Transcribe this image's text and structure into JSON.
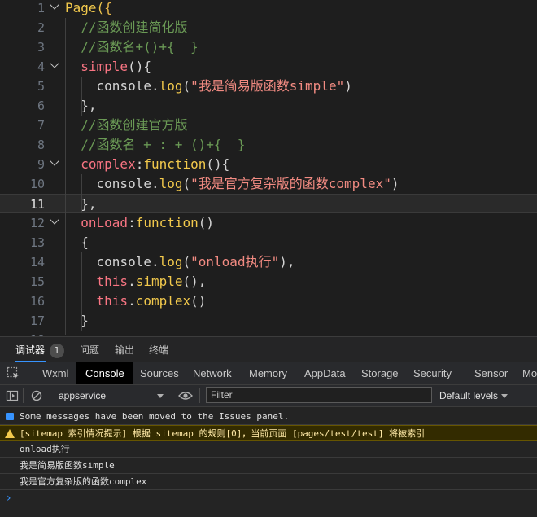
{
  "editor": {
    "lines": [
      {
        "n": "1",
        "segments": [
          {
            "t": "Page(",
            "c": "c-func"
          },
          {
            "t": "{",
            "c": "c-brace"
          }
        ]
      },
      {
        "n": "2",
        "segments": [
          {
            "t": "  //函数创建简化版",
            "c": "c-comment"
          }
        ]
      },
      {
        "n": "3",
        "segments": [
          {
            "t": "  //函数名+()+{  }",
            "c": "c-comment"
          }
        ]
      },
      {
        "n": "4",
        "segments": [
          {
            "t": "  ",
            "c": "c-punc"
          },
          {
            "t": "simple",
            "c": "c-prop"
          },
          {
            "t": "(){",
            "c": "c-punc"
          }
        ]
      },
      {
        "n": "5",
        "segments": [
          {
            "t": "    console.",
            "c": "c-punc"
          },
          {
            "t": "log",
            "c": "c-func"
          },
          {
            "t": "(",
            "c": "c-punc"
          },
          {
            "t": "\"我是简易版函数simple\"",
            "c": "c-str"
          },
          {
            "t": ")",
            "c": "c-punc"
          }
        ]
      },
      {
        "n": "6",
        "segments": [
          {
            "t": "  },",
            "c": "c-punc"
          }
        ]
      },
      {
        "n": "7",
        "segments": [
          {
            "t": "  //函数创建官方版",
            "c": "c-comment"
          }
        ]
      },
      {
        "n": "8",
        "segments": [
          {
            "t": "  //函数名 + : + ()+{  }",
            "c": "c-comment"
          }
        ]
      },
      {
        "n": "9",
        "segments": [
          {
            "t": "  ",
            "c": "c-punc"
          },
          {
            "t": "complex",
            "c": "c-prop"
          },
          {
            "t": ":",
            "c": "c-punc"
          },
          {
            "t": "function",
            "c": "c-func"
          },
          {
            "t": "(){",
            "c": "c-punc"
          }
        ]
      },
      {
        "n": "10",
        "segments": [
          {
            "t": "    console.",
            "c": "c-punc"
          },
          {
            "t": "log",
            "c": "c-func"
          },
          {
            "t": "(",
            "c": "c-punc"
          },
          {
            "t": "\"我是官方复杂版的函数complex\"",
            "c": "c-str"
          },
          {
            "t": ")",
            "c": "c-punc"
          }
        ]
      },
      {
        "n": "11",
        "segments": [
          {
            "t": "  },",
            "c": "c-punc"
          }
        ]
      },
      {
        "n": "12",
        "segments": [
          {
            "t": "  ",
            "c": "c-punc"
          },
          {
            "t": "onLoad",
            "c": "c-prop"
          },
          {
            "t": ":",
            "c": "c-punc"
          },
          {
            "t": "function",
            "c": "c-func"
          },
          {
            "t": "()",
            "c": "c-punc"
          }
        ]
      },
      {
        "n": "13",
        "segments": [
          {
            "t": "  {",
            "c": "c-punc"
          }
        ]
      },
      {
        "n": "14",
        "segments": [
          {
            "t": "    console.",
            "c": "c-punc"
          },
          {
            "t": "log",
            "c": "c-func"
          },
          {
            "t": "(",
            "c": "c-punc"
          },
          {
            "t": "\"onload执行\"",
            "c": "c-str"
          },
          {
            "t": "),",
            "c": "c-punc"
          }
        ]
      },
      {
        "n": "15",
        "segments": [
          {
            "t": "    ",
            "c": "c-punc"
          },
          {
            "t": "this",
            "c": "c-kw"
          },
          {
            "t": ".",
            "c": "c-punc"
          },
          {
            "t": "simple",
            "c": "c-func"
          },
          {
            "t": "(),",
            "c": "c-punc"
          }
        ]
      },
      {
        "n": "16",
        "segments": [
          {
            "t": "    ",
            "c": "c-punc"
          },
          {
            "t": "this",
            "c": "c-kw"
          },
          {
            "t": ".",
            "c": "c-punc"
          },
          {
            "t": "complex",
            "c": "c-func"
          },
          {
            "t": "()",
            "c": "c-punc"
          }
        ]
      },
      {
        "n": "17",
        "segments": [
          {
            "t": "  }",
            "c": "c-punc"
          }
        ]
      },
      {
        "n": "18",
        "segments": []
      }
    ],
    "active_line": "11",
    "fold_lines": [
      "1",
      "4",
      "9",
      "12"
    ]
  },
  "panel_tabs": {
    "debugger": "调试器",
    "debugger_count": "1",
    "problems": "问题",
    "output": "输出",
    "terminal": "终端"
  },
  "devtools_tabs": [
    "Wxml",
    "Console",
    "Sources",
    "Network",
    "Memory",
    "AppData",
    "Storage",
    "Security",
    "Sensor",
    "Mo"
  ],
  "devtools_active_tab": "Console",
  "toolbar": {
    "context": "appservice",
    "filter_placeholder": "Filter",
    "levels": "Default levels"
  },
  "console": {
    "messages": [
      {
        "type": "info",
        "text": "Some messages have been moved to the Issues panel."
      },
      {
        "type": "warn",
        "text": "[sitemap 索引情况提示] 根据 sitemap 的规则[0]，当前页面 [pages/test/test] 将被索引"
      },
      {
        "type": "log",
        "text": "onload执行"
      },
      {
        "type": "log",
        "text": "我是简易版函数simple"
      },
      {
        "type": "log",
        "text": "我是官方复杂版的函数complex"
      }
    ],
    "prompt": "›"
  },
  "colors": {
    "comment": "#6a9955",
    "property": "#f97583",
    "function": "#f2c94c",
    "string": "#f28b82",
    "warn_bg": "#332b00",
    "info_icon": "#3794ff",
    "warn_icon": "#f2c94c"
  }
}
